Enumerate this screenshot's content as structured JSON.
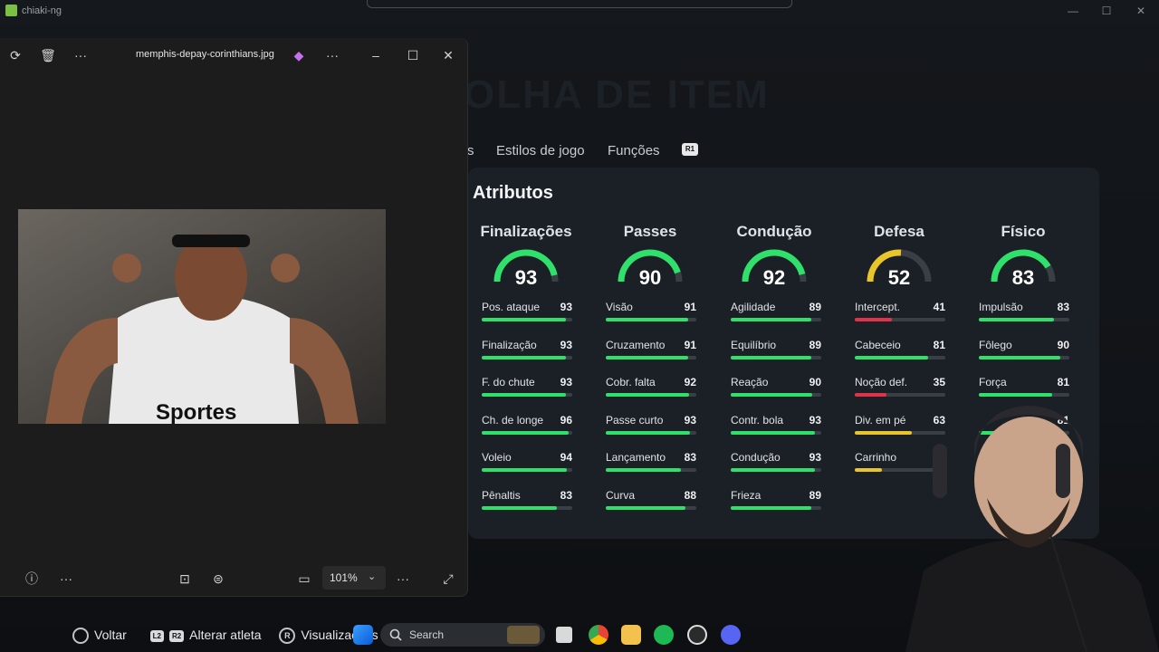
{
  "host": {
    "title": "chiaki-ng",
    "controls": [
      "—",
      "☐",
      "✕"
    ]
  },
  "game": {
    "page_title": "OLHA DE ITEM",
    "tabs": [
      "s",
      "Estilos de jogo",
      "Funções"
    ],
    "r1_label": "R1",
    "section_title": "Atributos",
    "categories": [
      {
        "name": "Finalizações",
        "rating": "93",
        "color": "#2fe06a",
        "stats": [
          {
            "label": "Pos. ataque",
            "value": "93"
          },
          {
            "label": "Finalização",
            "value": "93"
          },
          {
            "label": "F. do chute",
            "value": "93"
          },
          {
            "label": "Ch. de longe",
            "value": "96"
          },
          {
            "label": "Voleio",
            "value": "94"
          },
          {
            "label": "Pênaltis",
            "value": "83"
          }
        ]
      },
      {
        "name": "Passes",
        "rating": "90",
        "color": "#2fe06a",
        "stats": [
          {
            "label": "Visão",
            "value": "91"
          },
          {
            "label": "Cruzamento",
            "value": "91"
          },
          {
            "label": "Cobr. falta",
            "value": "92"
          },
          {
            "label": "Passe curto",
            "value": "93"
          },
          {
            "label": "Lançamento",
            "value": "83"
          },
          {
            "label": "Curva",
            "value": "88"
          }
        ]
      },
      {
        "name": "Condução",
        "rating": "92",
        "color": "#2fe06a",
        "stats": [
          {
            "label": "Agilidade",
            "value": "89"
          },
          {
            "label": "Equilíbrio",
            "value": "89"
          },
          {
            "label": "Reação",
            "value": "90"
          },
          {
            "label": "Contr. bola",
            "value": "93"
          },
          {
            "label": "Condução",
            "value": "93"
          },
          {
            "label": "Frieza",
            "value": "89"
          }
        ]
      },
      {
        "name": "Defesa",
        "rating": "52",
        "color": "#e8c52a",
        "stats": [
          {
            "label": "Intercept.",
            "value": "41"
          },
          {
            "label": "Cabeceio",
            "value": "81"
          },
          {
            "label": "Noção def.",
            "value": "35"
          },
          {
            "label": "Div. em pé",
            "value": "63"
          },
          {
            "label": "Carrinho",
            "value": ""
          }
        ]
      },
      {
        "name": "Físico",
        "rating": "83",
        "color": "#2fe06a",
        "stats": [
          {
            "label": "Impulsão",
            "value": "83"
          },
          {
            "label": "Fôlego",
            "value": "90"
          },
          {
            "label": "Força",
            "value": "81"
          },
          {
            "label": "",
            "value": "81"
          }
        ]
      }
    ],
    "hints": {
      "back": "Voltar",
      "switch": "Alterar atleta",
      "view": "Visualizações",
      "l2": "L2",
      "r2": "R2",
      "r": "R"
    }
  },
  "photos": {
    "filename": "memphis-depay-corinthians.jpg",
    "zoom": "101%",
    "image_caption": "Sportes"
  },
  "taskbar": {
    "search_placeholder": "Search"
  }
}
